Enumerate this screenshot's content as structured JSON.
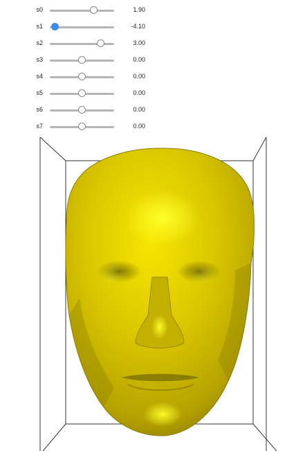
{
  "sliders": [
    {
      "label": "s0",
      "value": 1.9,
      "display": "1.90",
      "active": false
    },
    {
      "label": "s1",
      "value": -4.1,
      "display": "-4.10",
      "active": true
    },
    {
      "label": "s2",
      "value": 3.0,
      "display": "3.00",
      "active": false
    },
    {
      "label": "s3",
      "value": 0.0,
      "display": "0.00",
      "active": false
    },
    {
      "label": "s4",
      "value": 0.0,
      "display": "0.00",
      "active": false
    },
    {
      "label": "s5",
      "value": 0.0,
      "display": "0.00",
      "active": false
    },
    {
      "label": "s6",
      "value": 0.0,
      "display": "0.00",
      "active": false
    },
    {
      "label": "s7",
      "value": 0.0,
      "display": "0.00",
      "active": false
    }
  ],
  "slider_range": [
    -5,
    5
  ],
  "colors": {
    "accent": "#3b8ee6",
    "face": "#d4c200",
    "box": "#333333"
  }
}
